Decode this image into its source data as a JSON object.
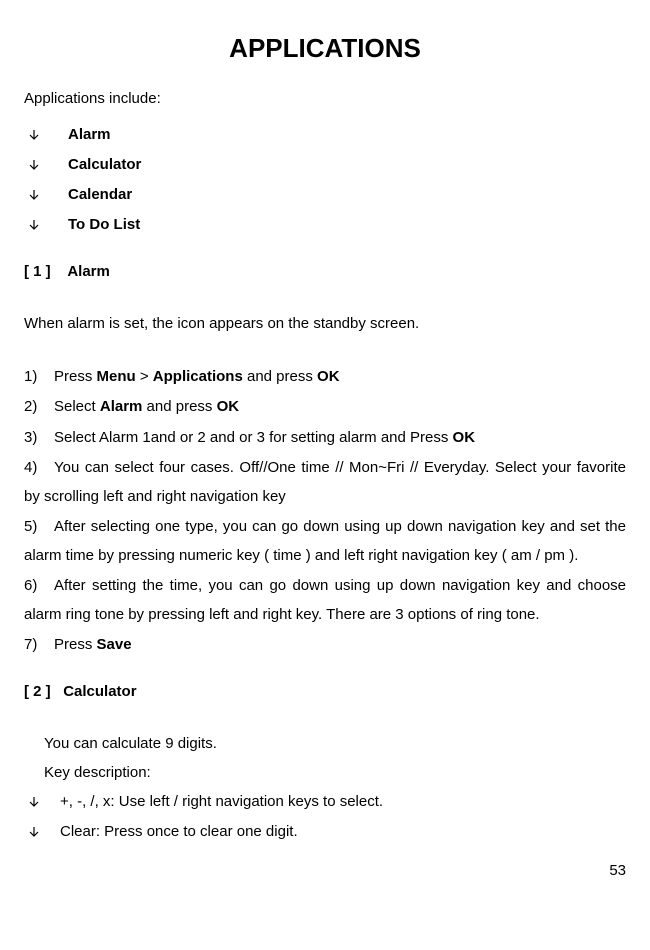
{
  "title": "APPLICATIONS",
  "intro": "Applications include:",
  "bullets": {
    "b1": "Alarm",
    "b2": "Calculator",
    "b3": "Calendar",
    "b4": "To Do List"
  },
  "section1": {
    "heading_num": "[ 1 ]",
    "heading_label": "Alarm",
    "desc": "When alarm is set, the icon appears on the standby screen.",
    "steps": {
      "s1a": "Press ",
      "s1_menu": "Menu",
      "s1_gt": " > ",
      "s1_apps": "Applications",
      "s1_and": " and press ",
      "s1_ok": "OK",
      "s2a": "Select ",
      "s2_alarm": "Alarm",
      "s2_b": " and press ",
      "s2_ok": "OK",
      "s3a": "Select Alarm 1and or 2 and or 3 for setting alarm and Press ",
      "s3_ok": "OK",
      "s4": "You can select four cases. Off//One time // Mon~Fri // Everyday. Select your favorite by scrolling left and right navigation key",
      "s5": "After selecting one type, you can go down using up down navigation key and set the alarm time by pressing numeric key ( time ) and left right navigation key ( am / pm ).",
      "s6": "After setting the time, you can go down using up down navigation key and choose alarm ring tone by pressing left and right key. There are 3 options of ring tone.",
      "s7a": "Press ",
      "s7_save": "Save"
    }
  },
  "section2": {
    "heading_num": "[ 2 ]",
    "heading_label": "Calculator",
    "line1": "You can calculate 9 digits.",
    "line2": "Key description:",
    "k1": "+, -, /, x: Use left / right navigation keys to select.",
    "k2": "Clear: Press once to clear one digit."
  },
  "page_number": "53"
}
